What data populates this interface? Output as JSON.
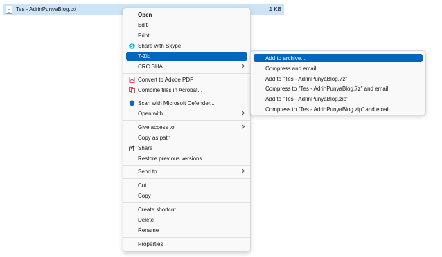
{
  "file": {
    "name": "Tes - AdrinPunyaBlog.txt",
    "size": "1 KB"
  },
  "menu": {
    "items": [
      {
        "label": "Open"
      },
      {
        "label": "Edit"
      },
      {
        "label": "Print"
      },
      {
        "label": "Share with Skype"
      },
      {
        "label": "7-Zip"
      },
      {
        "label": "CRC SHA"
      },
      {
        "label": "Convert to Adobe PDF"
      },
      {
        "label": "Combine files in Acrobat..."
      },
      {
        "label": "Scan with Microsoft Defender..."
      },
      {
        "label": "Open with"
      },
      {
        "label": "Give access to"
      },
      {
        "label": "Copy as path"
      },
      {
        "label": "Share"
      },
      {
        "label": "Restore previous versions"
      },
      {
        "label": "Send to"
      },
      {
        "label": "Cut"
      },
      {
        "label": "Copy"
      },
      {
        "label": "Create shortcut"
      },
      {
        "label": "Delete"
      },
      {
        "label": "Rename"
      },
      {
        "label": "Properties"
      }
    ]
  },
  "submenu": {
    "items": [
      {
        "label": "Add to archive..."
      },
      {
        "label": "Compress and email..."
      },
      {
        "label": "Add to \"Tes - AdrinPunyaBlog.7z\""
      },
      {
        "label": "Compress to \"Tes - AdrinPunyaBlog.7z\" and email"
      },
      {
        "label": "Add to \"Tes - AdrinPunyaBlog.zip\""
      },
      {
        "label": "Compress to \"Tes - AdrinPunyaBlog.zip\" and email"
      }
    ]
  },
  "colors": {
    "selection": "#0067c0",
    "file_highlight": "#cce4f7",
    "skype": "#00aff0",
    "adobe": "#d4252b",
    "defender": "#1565c0"
  }
}
